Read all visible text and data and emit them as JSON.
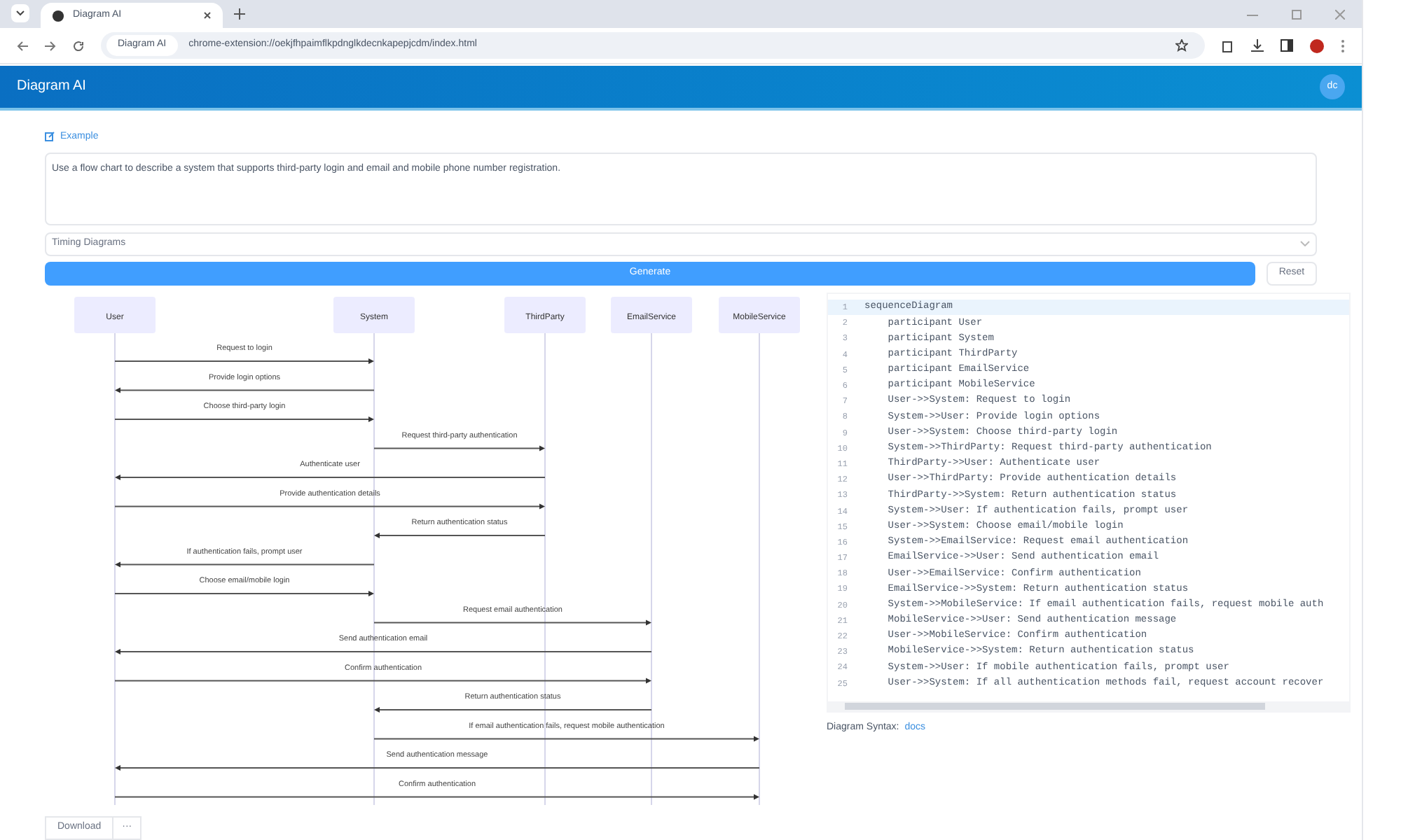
{
  "browser": {
    "tab_title": "Diagram AI",
    "site_chip": "Diagram AI",
    "url": "chrome-extension://oekjfhpaimflkpdnglkdecnkapepjcdm/index.html"
  },
  "header": {
    "title": "Diagram AI",
    "avatar": "dc"
  },
  "example_link": "Example",
  "prompt": {
    "value": "Use a flow chart to describe a system that supports third-party login and email and mobile phone number registration."
  },
  "diagram_type": {
    "value": "Timing Diagrams"
  },
  "buttons": {
    "generate": "Generate",
    "reset": "Reset",
    "download": "Download",
    "download_more": "···"
  },
  "diagram": {
    "participants": [
      "User",
      "System",
      "ThirdParty",
      "EmailService",
      "MobileService"
    ],
    "messages": [
      {
        "label": "Request to login"
      },
      {
        "label": "Provide login options"
      },
      {
        "label": "Choose third-party login"
      },
      {
        "label": "Request third-party authentication"
      },
      {
        "label": "Authenticate user"
      },
      {
        "label": "Provide authentication details"
      },
      {
        "label": "Return authentication status"
      },
      {
        "label": "If authentication fails, prompt user"
      },
      {
        "label": "Choose email/mobile login"
      },
      {
        "label": "Request email authentication"
      },
      {
        "label": "Send authentication email"
      },
      {
        "label": "Confirm authentication"
      },
      {
        "label": "Return authentication status"
      },
      {
        "label": "If email authentication fails, request mobile authentication"
      },
      {
        "label": "Send authentication message"
      },
      {
        "label": "Confirm authentication"
      }
    ]
  },
  "editor": {
    "lines": [
      {
        "number": "1",
        "code": "sequenceDiagram",
        "selected": true
      },
      {
        "number": "2",
        "code": "    participant User",
        "selected": false
      },
      {
        "number": "3",
        "code": "    participant System",
        "selected": false
      },
      {
        "number": "4",
        "code": "    participant ThirdParty",
        "selected": false
      },
      {
        "number": "5",
        "code": "    participant EmailService",
        "selected": false
      },
      {
        "number": "6",
        "code": "    participant MobileService",
        "selected": false
      },
      {
        "number": "7",
        "code": "    User->>System: Request to login",
        "selected": false
      },
      {
        "number": "8",
        "code": "    System->>User: Provide login options",
        "selected": false
      },
      {
        "number": "9",
        "code": "    User->>System: Choose third-party login",
        "selected": false
      },
      {
        "number": "10",
        "code": "    System->>ThirdParty: Request third-party authentication",
        "selected": false
      },
      {
        "number": "11",
        "code": "    ThirdParty->>User: Authenticate user",
        "selected": false
      },
      {
        "number": "12",
        "code": "    User->>ThirdParty: Provide authentication details",
        "selected": false
      },
      {
        "number": "13",
        "code": "    ThirdParty->>System: Return authentication status",
        "selected": false
      },
      {
        "number": "14",
        "code": "    System->>User: If authentication fails, prompt user",
        "selected": false
      },
      {
        "number": "15",
        "code": "    User->>System: Choose email/mobile login",
        "selected": false
      },
      {
        "number": "16",
        "code": "    System->>EmailService: Request email authentication",
        "selected": false
      },
      {
        "number": "17",
        "code": "    EmailService->>User: Send authentication email",
        "selected": false
      },
      {
        "number": "18",
        "code": "    User->>EmailService: Confirm authentication",
        "selected": false
      },
      {
        "number": "19",
        "code": "    EmailService->>System: Return authentication status",
        "selected": false
      },
      {
        "number": "20",
        "code": "    System->>MobileService: If email authentication fails, request mobile auth",
        "selected": false
      },
      {
        "number": "21",
        "code": "    MobileService->>User: Send authentication message",
        "selected": false
      },
      {
        "number": "22",
        "code": "    User->>MobileService: Confirm authentication",
        "selected": false
      },
      {
        "number": "23",
        "code": "    MobileService->>System: Return authentication status",
        "selected": false
      },
      {
        "number": "24",
        "code": "    System->>User: If mobile authentication fails, prompt user",
        "selected": false
      },
      {
        "number": "25",
        "code": "    User->>System: If all authentication methods fail, request account recover",
        "selected": false
      }
    ]
  },
  "syntax_note": {
    "label": "Diagram Syntax:",
    "link": "docs"
  }
}
